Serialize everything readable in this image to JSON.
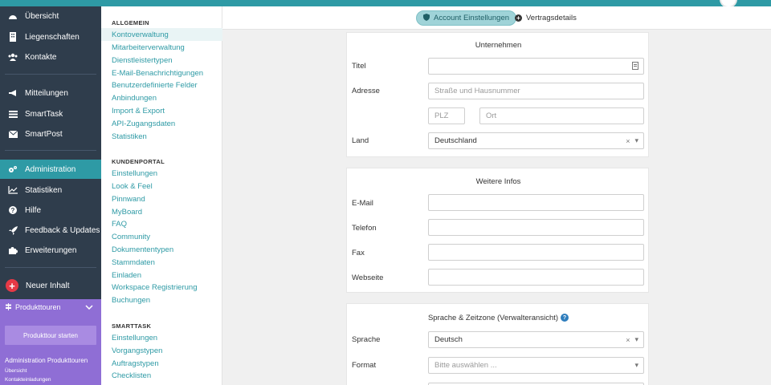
{
  "nav": {
    "items": [
      {
        "label": "Übersicht",
        "icon": "dashboard-icon"
      },
      {
        "label": "Liegenschaften",
        "icon": "building-icon"
      },
      {
        "label": "Kontakte",
        "icon": "users-icon"
      },
      {
        "label": "Mitteilungen",
        "icon": "megaphone-icon"
      },
      {
        "label": "SmartTask",
        "icon": "list-icon"
      },
      {
        "label": "SmartPost",
        "icon": "envelope-icon"
      },
      {
        "label": "Administration",
        "icon": "gears-icon"
      },
      {
        "label": "Statistiken",
        "icon": "chart-icon"
      },
      {
        "label": "Hilfe",
        "icon": "question-icon"
      },
      {
        "label": "Feedback & Updates",
        "icon": "rocket-icon"
      },
      {
        "label": "Erweiterungen",
        "icon": "puzzle-icon"
      }
    ],
    "new_content": "Neuer Inhalt",
    "tour": {
      "header": "Produkttouren",
      "start_button": "Produkttour starten",
      "title": "Administration Produkttouren",
      "links": [
        "Übersicht",
        "Kontakteinladungen"
      ]
    }
  },
  "settings": {
    "sections": [
      {
        "title": "ALLGEMEIN",
        "links": [
          "Kontoverwaltung",
          "Mitarbeiterverwaltung",
          "Dienstleistertypen",
          "E-Mail-Benachrichtigungen",
          "Benutzerdefinierte Felder",
          "Anbindungen",
          "Import & Export",
          "API-Zugangsdaten",
          "Statistiken"
        ]
      },
      {
        "title": "KUNDENPORTAL",
        "links": [
          "Einstellungen",
          "Look & Feel",
          "Pinnwand",
          "MyBoard",
          "FAQ",
          "Community",
          "Dokumententypen",
          "Stammdaten",
          "Einladen",
          "Workspace Registrierung",
          "Buchungen"
        ]
      },
      {
        "title": "SMARTTASK",
        "links": [
          "Einstellungen",
          "Vorgangstypen",
          "Auftragstypen",
          "Checklisten"
        ]
      }
    ]
  },
  "tabs": {
    "account": "Account Einstellungen",
    "contract": "Vertragsdetails"
  },
  "company": {
    "title": "Unternehmen",
    "titel_label": "Titel",
    "address_label": "Adresse",
    "street_placeholder": "Straße und Hausnummer",
    "zip_placeholder": "PLZ",
    "city_placeholder": "Ort",
    "country_label": "Land",
    "country_value": "Deutschland"
  },
  "more_info": {
    "title": "Weitere Infos",
    "email_label": "E-Mail",
    "phone_label": "Telefon",
    "fax_label": "Fax",
    "website_label": "Webseite"
  },
  "language": {
    "title": "Sprache & Zeitzone (Verwalteransicht)",
    "language_label": "Sprache",
    "language_value": "Deutsch",
    "format_label": "Format",
    "format_placeholder": "Bitte auswählen ..."
  },
  "colors": {
    "accent": "#2e9aa5",
    "nav_bg": "#2f3d4c",
    "tour_bg": "#8f6ed5",
    "new_content": "#e63946"
  }
}
